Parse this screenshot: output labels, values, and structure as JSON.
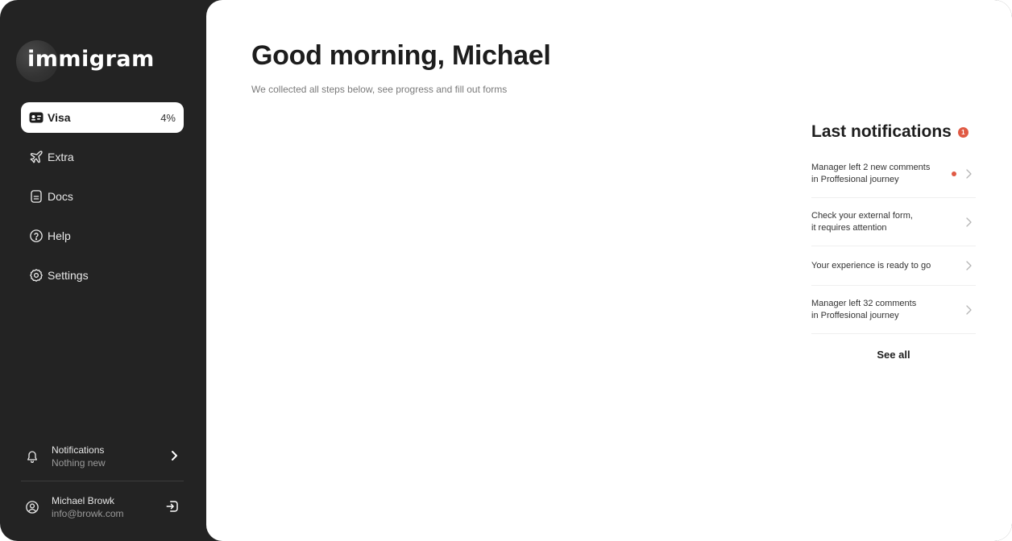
{
  "app": {
    "logo_text": "immigram"
  },
  "sidebar": {
    "items": [
      {
        "label": "Visa",
        "icon": "id-card-icon",
        "badge": "4%",
        "active": true
      },
      {
        "label": "Extra",
        "icon": "plane-icon"
      },
      {
        "label": "Docs",
        "icon": "document-icon"
      },
      {
        "label": "Help",
        "icon": "help-icon"
      },
      {
        "label": "Settings",
        "icon": "gear-icon"
      }
    ],
    "notifications": {
      "title": "Notifications",
      "subtitle": "Nothing new"
    },
    "user": {
      "name": "Michael Browk",
      "email": "info@browk.com"
    }
  },
  "main": {
    "greeting": "Good morning, Michael",
    "subtitle": "We collected all steps below, see progress and fill out forms"
  },
  "notifications_panel": {
    "title": "Last notifications",
    "badge_count": "1",
    "items": [
      {
        "line1": "Manager left 2 new comments",
        "line2": "in Proffesional journey",
        "unread": true
      },
      {
        "line1": "Check your external form,",
        "line2": "it requires attention",
        "unread": false
      },
      {
        "line1": "Your experience is ready to go",
        "line2": "",
        "unread": false
      },
      {
        "line1": "Manager left 32 comments",
        "line2": "in Proffesional journey",
        "unread": false
      }
    ],
    "see_all": "See all"
  },
  "colors": {
    "sidebar_bg": "#232323",
    "accent_red": "#e05a44",
    "main_bg": "#ffffff"
  }
}
